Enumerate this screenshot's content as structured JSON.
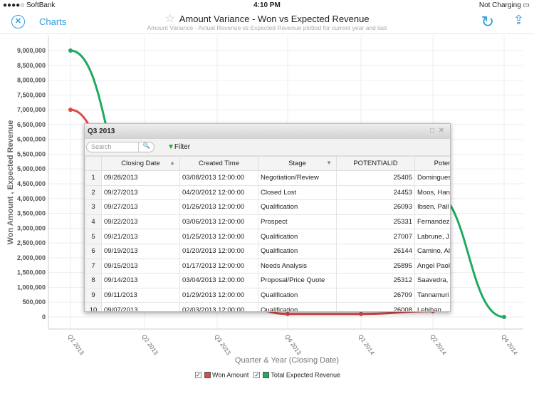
{
  "status": {
    "carrier": "●●●●○ SoftBank",
    "time": "4:10 PM",
    "battery": "Not Charging"
  },
  "nav": {
    "back_label": "Charts",
    "title": "Amount Variance - Won vs Expected Revenue",
    "subtitle": "Amount Variance - Actual Revenue vs Expected Revenue plotted for current year and last"
  },
  "chart_data": {
    "type": "line",
    "xlabel": "Quarter & Year (Closing Date)",
    "ylabel": "Won Amount , Expected Revenue",
    "categories": [
      "Q1 2013",
      "Q2 2013",
      "Q3 2013",
      "Q4 2013",
      "Q1 2014",
      "Q2 2014",
      "Q4 2014"
    ],
    "yticks": [
      "0",
      "500,000",
      "1,000,000",
      "1,500,000",
      "2,000,000",
      "2,500,000",
      "3,000,000",
      "3,500,000",
      "4,000,000",
      "4,500,000",
      "5,000,000",
      "5,500,000",
      "6,000,000",
      "6,500,000",
      "7,000,000",
      "7,500,000",
      "8,000,000",
      "8,500,000",
      "9,000,000"
    ],
    "ylim": [
      0,
      9000000
    ],
    "grid": true,
    "legend": "bottom",
    "series": [
      {
        "name": "Won Amount",
        "color": "#e04848",
        "values": [
          7000000,
          2000000,
          800000,
          100000,
          100000,
          200000,
          null
        ]
      },
      {
        "name": "Total Expected Revenue",
        "color": "#1faa60",
        "values": [
          9000000,
          3500000,
          2000000,
          1000000,
          2500000,
          4200000,
          0
        ]
      }
    ]
  },
  "popup": {
    "title": "Q3 2013",
    "search_placeholder": "Search",
    "filter_label": "Filter",
    "columns": [
      "",
      "Closing Date",
      "Created Time",
      "Stage",
      "POTENTIALID",
      "Poter"
    ],
    "rows": [
      [
        "1",
        "09/28/2013",
        "03/08/2013 12:00:00",
        "Negotiation/Review",
        "25405",
        "Domingues"
      ],
      [
        "2",
        "09/27/2013",
        "04/20/2012 12:00:00",
        "Closed Lost",
        "24453",
        "Moos, Han"
      ],
      [
        "3",
        "09/27/2013",
        "01/26/2013 12:00:00",
        "Qualification",
        "26093",
        "Ibsen, Pall"
      ],
      [
        "4",
        "09/22/2013",
        "03/06/2013 12:00:00",
        "Prospect",
        "25331",
        "Fernandez,"
      ],
      [
        "5",
        "09/21/2013",
        "01/25/2013 12:00:00",
        "Qualification",
        "27007",
        "Labrune, J."
      ],
      [
        "6",
        "09/19/2013",
        "01/20/2013 12:00:00",
        "Qualification",
        "26144",
        "Camino, Al"
      ],
      [
        "7",
        "09/15/2013",
        "01/17/2013 12:00:00",
        "Needs Analysis",
        "25895",
        "Angel Paol"
      ],
      [
        "8",
        "09/14/2013",
        "03/04/2013 12:00:00",
        "Proposal/Price Quote",
        "25312",
        "Saavedra,"
      ],
      [
        "9",
        "09/11/2013",
        "01/29/2013 12:00:00",
        "Qualification",
        "26709",
        "Tannamuri"
      ],
      [
        "10",
        "09/07/2013",
        "02/03/2013 12:00:00",
        "Qualification",
        "26008",
        "Lebihan,"
      ]
    ]
  }
}
